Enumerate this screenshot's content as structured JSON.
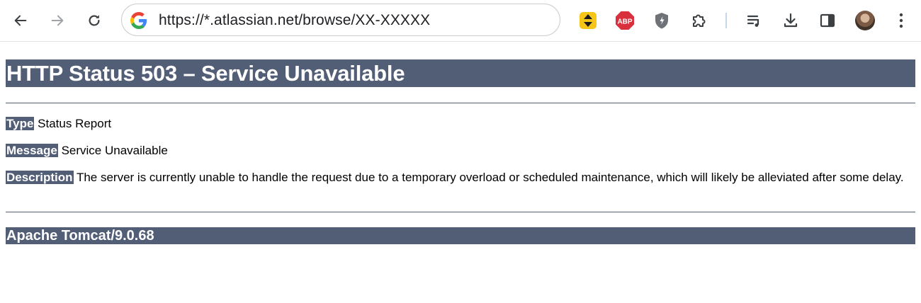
{
  "browser": {
    "url": "https://*.atlassian.net/browse/XX-XXXXX",
    "toolbar_icons": {
      "back": "back-arrow-icon",
      "forward": "forward-arrow-icon",
      "reload": "reload-icon",
      "site_info": "google-g-icon",
      "ext1": "sort-arrows-extension-icon",
      "ext2": "adblock-plus-icon",
      "ext3": "shield-extension-icon",
      "extensions": "puzzle-extensions-icon",
      "media": "media-queue-icon",
      "downloads": "download-icon",
      "sidepanel": "side-panel-icon",
      "profile": "profile-avatar",
      "menu": "kebab-menu-icon"
    },
    "abp_label": "ABP"
  },
  "page": {
    "title": "HTTP Status 503 – Service Unavailable",
    "type_label": "Type",
    "type_value": "Status Report",
    "message_label": "Message",
    "message_value": "Service Unavailable",
    "description_label": "Description",
    "description_value": "The server is currently unable to handle the request due to a temporary overload or scheduled maintenance, which will likely be alleviated after some delay.",
    "footer": "Apache Tomcat/9.0.68"
  },
  "colors": {
    "header_bar": "#525d76",
    "label_bg": "#525d76",
    "text": "#000000"
  }
}
